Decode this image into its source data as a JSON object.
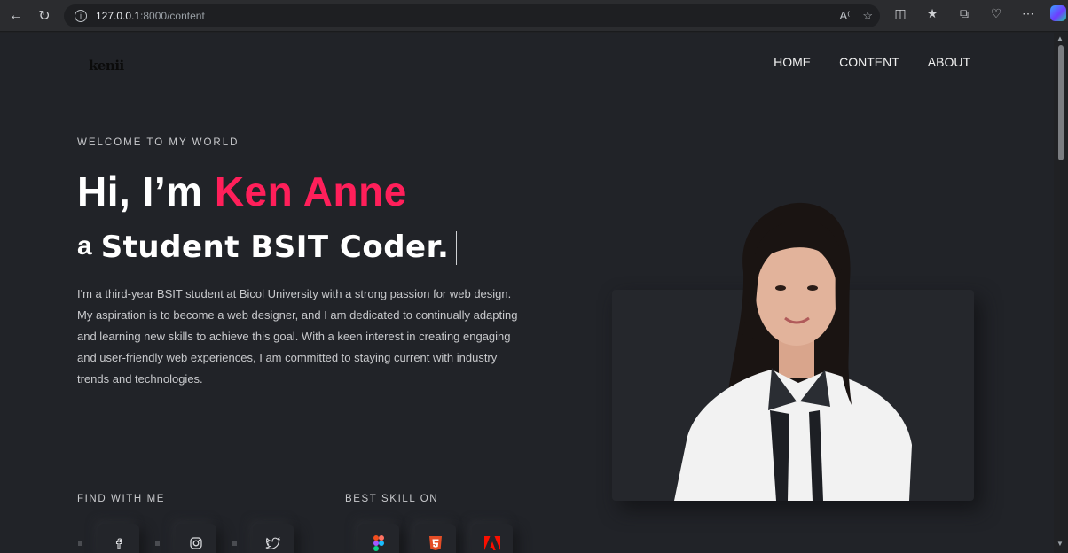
{
  "browser": {
    "url_host": "127.0.0.1",
    "url_path": ":8000/content"
  },
  "site": {
    "logo": "kenii",
    "nav": [
      "HOME",
      "CONTENT",
      "ABOUT"
    ]
  },
  "hero": {
    "eyebrow": "WELCOME TO MY WORLD",
    "greeting": "Hi, I’m ",
    "name": "Ken Anne",
    "prefix": "a",
    "role": "Student BSIT Coder.",
    "description": "I'm a third-year BSIT student at Bicol University with a strong passion for web design. My aspiration is to become a web designer, and I am dedicated to continually adapting and learning new skills to achieve this goal. With a keen interest in creating engaging and user-friendly web experiences, I am committed to staying current with industry trends and technologies."
  },
  "find": {
    "label": "FIND WITH ME",
    "icons": [
      "facebook-icon",
      "instagram-icon",
      "twitter-icon"
    ]
  },
  "skills": {
    "label": "BEST SKILL ON",
    "icons": [
      "figma-icon",
      "html5-icon",
      "adobe-icon"
    ]
  },
  "colors": {
    "accent": "#ff1f5a",
    "background": "#212328"
  }
}
